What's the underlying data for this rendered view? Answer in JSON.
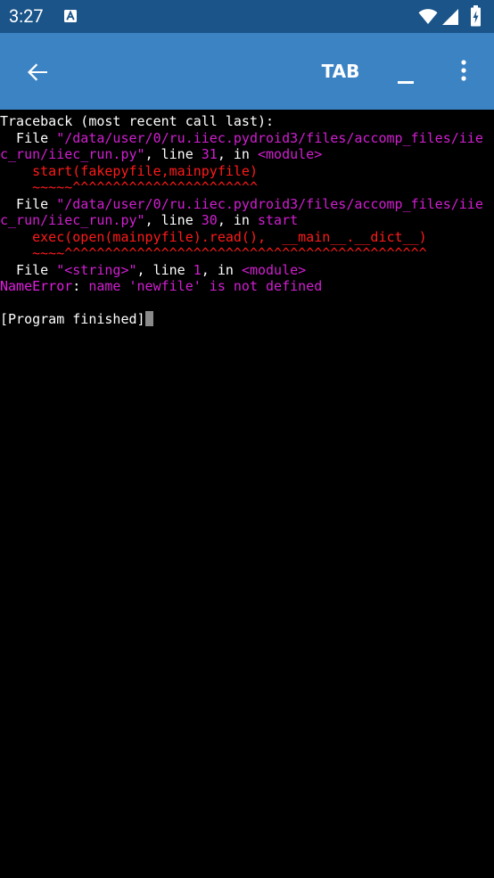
{
  "status_bar": {
    "time": "3:27",
    "bg_color": "#1a5489",
    "icons": [
      "a-notification-icon",
      "wifi-icon",
      "cell-signal-icon",
      "battery-charging-icon"
    ]
  },
  "app_bar": {
    "bg_color": "#3c83c4",
    "back_icon": "back-arrow-icon",
    "tab_label": "TAB",
    "underscore_label": "_",
    "overflow_icon": "more-vert-icon"
  },
  "terminal": {
    "bg_color": "#000000",
    "lines": [
      {
        "segments": [
          {
            "text": "Traceback (most recent call last):",
            "color": "white"
          }
        ]
      },
      {
        "segments": [
          {
            "text": "  File ",
            "color": "white"
          },
          {
            "text": "\"/data/user/0/ru.iiec.pydroid3/files/accomp_files/iie",
            "color": "mag"
          }
        ]
      },
      {
        "segments": [
          {
            "text": "c_run/iiec_run.py\"",
            "color": "mag"
          },
          {
            "text": ", line ",
            "color": "white"
          },
          {
            "text": "31",
            "color": "mag"
          },
          {
            "text": ", in ",
            "color": "white"
          },
          {
            "text": "<module>",
            "color": "mag"
          }
        ]
      },
      {
        "segments": [
          {
            "text": "    start",
            "color": "red"
          },
          {
            "text": "(fakepyfile,mainpyfile)",
            "color": "redbold"
          }
        ]
      },
      {
        "segments": [
          {
            "text": "    ~~~~~",
            "color": "red"
          },
          {
            "text": "^^^^^^^^^^^^^^^^^^^^^^^",
            "color": "redbold"
          }
        ]
      },
      {
        "segments": [
          {
            "text": "  File ",
            "color": "white"
          },
          {
            "text": "\"/data/user/0/ru.iiec.pydroid3/files/accomp_files/iie",
            "color": "mag"
          }
        ]
      },
      {
        "segments": [
          {
            "text": "c_run/iiec_run.py\"",
            "color": "mag"
          },
          {
            "text": ", line ",
            "color": "white"
          },
          {
            "text": "30",
            "color": "mag"
          },
          {
            "text": ", in ",
            "color": "white"
          },
          {
            "text": "start",
            "color": "mag"
          }
        ]
      },
      {
        "segments": [
          {
            "text": "    exec",
            "color": "red"
          },
          {
            "text": "(open(mainpyfile).read(),  __main__.__dict__)",
            "color": "redbold"
          }
        ]
      },
      {
        "segments": [
          {
            "text": "    ~~~~",
            "color": "red"
          },
          {
            "text": "^^^^^^^^^^^^^^^^^^^^^^^^^^^^^^^^^^^^^^^^^^^^^",
            "color": "redbold"
          }
        ]
      },
      {
        "segments": [
          {
            "text": "  File ",
            "color": "white"
          },
          {
            "text": "\"<string>\"",
            "color": "mag"
          },
          {
            "text": ", line ",
            "color": "white"
          },
          {
            "text": "1",
            "color": "mag"
          },
          {
            "text": ", in ",
            "color": "white"
          },
          {
            "text": "<module>",
            "color": "mag"
          }
        ]
      },
      {
        "segments": [
          {
            "text": "NameError",
            "color": "magbold"
          },
          {
            "text": ": ",
            "color": "white"
          },
          {
            "text": "name 'newfile' is not defined",
            "color": "mag"
          }
        ]
      },
      {
        "segments": [
          {
            "text": "",
            "color": "white"
          }
        ]
      },
      {
        "segments": [
          {
            "text": "[Program finished]",
            "color": "white"
          }
        ],
        "cursor": true
      }
    ]
  }
}
